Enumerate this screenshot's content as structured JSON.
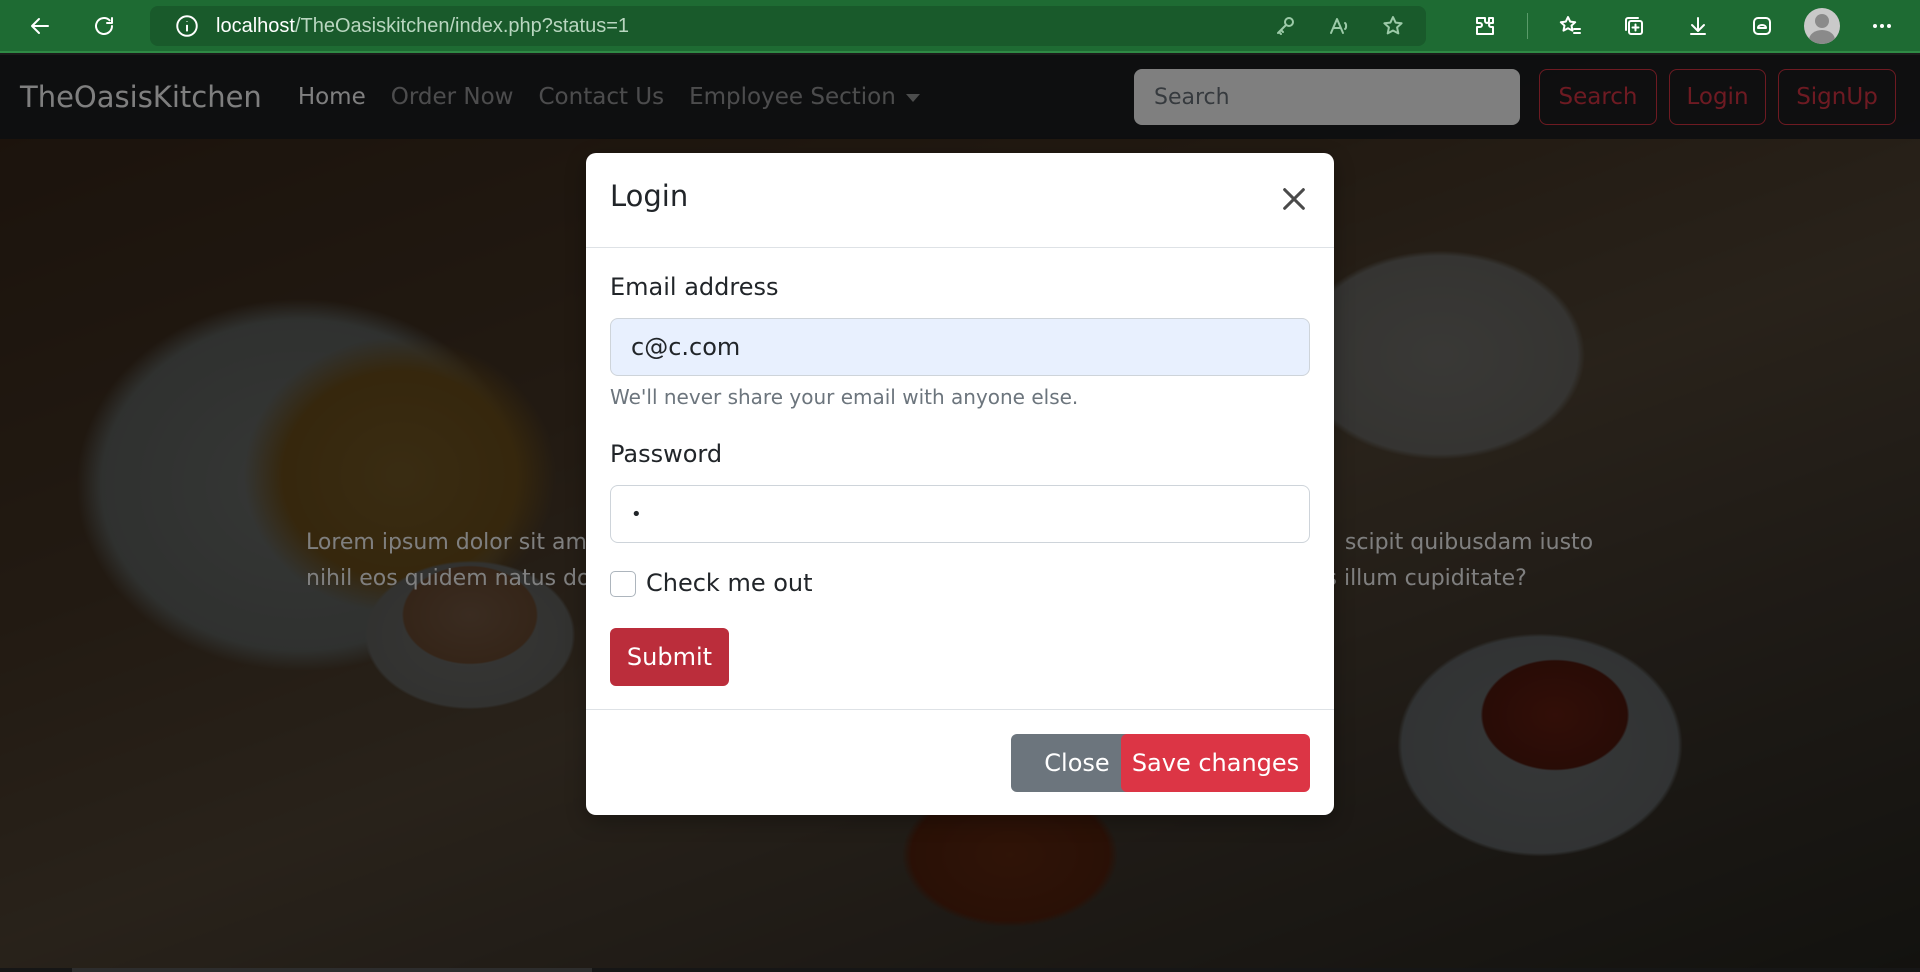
{
  "browser": {
    "url_host": "localhost",
    "url_path": "/TheOasiskitchen/index.php?status=1"
  },
  "navbar": {
    "brand": "TheOasisKitchen",
    "links": [
      "Home",
      "Order Now",
      "Contact Us",
      "Employee Section"
    ],
    "search_placeholder": "Search",
    "search_button": "Search",
    "login_button": "Login",
    "signup_button": "SignUp"
  },
  "hero": {
    "line1_left": "Lorem ipsum dolor sit am",
    "line1_right": "scipit quibusdam iusto",
    "line2_left": "nihil eos quidem natus do",
    "line2_right": "s illum cupiditate?"
  },
  "modal": {
    "title": "Login",
    "email_label": "Email address",
    "email_value": "c@c.com",
    "email_help": "We'll never share your email with anyone else.",
    "password_label": "Password",
    "password_value": "•",
    "checkbox_label": "Check me out",
    "submit_label": "Submit",
    "close_label": "Close",
    "save_label": "Save changes"
  },
  "colors": {
    "browser_chrome": "#1e6b33",
    "danger": "#dc3545",
    "secondary": "#6c757d",
    "autofill": "#e8f0fe"
  }
}
